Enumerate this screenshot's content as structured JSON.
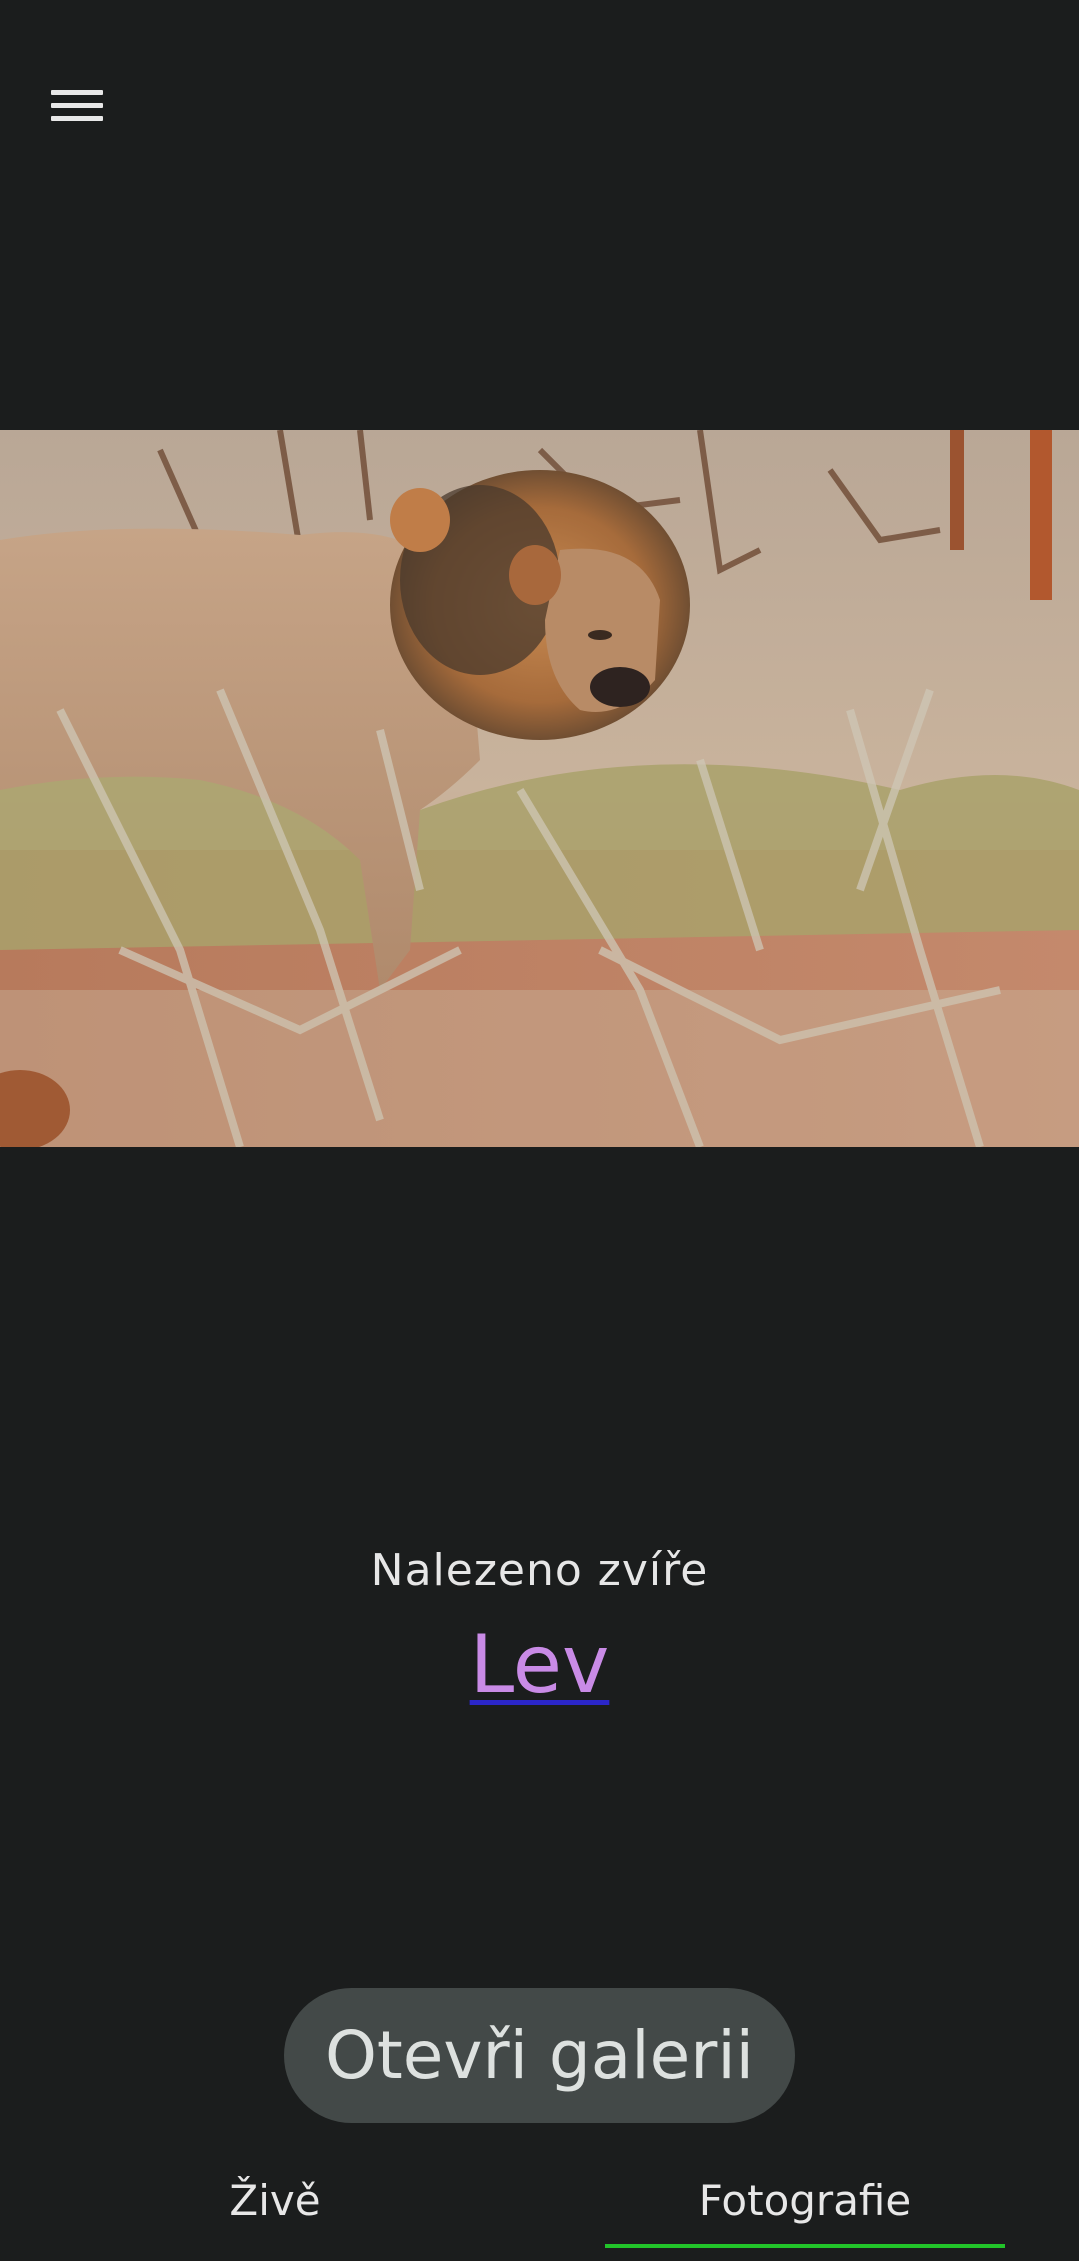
{
  "header": {
    "menu_icon": "hamburger-menu-icon"
  },
  "photo": {
    "alt": "Lev"
  },
  "result": {
    "label": "Nalezeno zvíře",
    "animal_name": "Lev"
  },
  "actions": {
    "open_gallery_label": "Otevři galerii"
  },
  "tabs": [
    {
      "label": "Živě",
      "selected": false
    },
    {
      "label": "Fotografie",
      "selected": true
    }
  ],
  "colors": {
    "background": "#1b1d1d",
    "link": "#c98be6",
    "link_underline": "#2b26c9",
    "button_bg": "#434948",
    "tab_indicator": "#22c42a"
  }
}
